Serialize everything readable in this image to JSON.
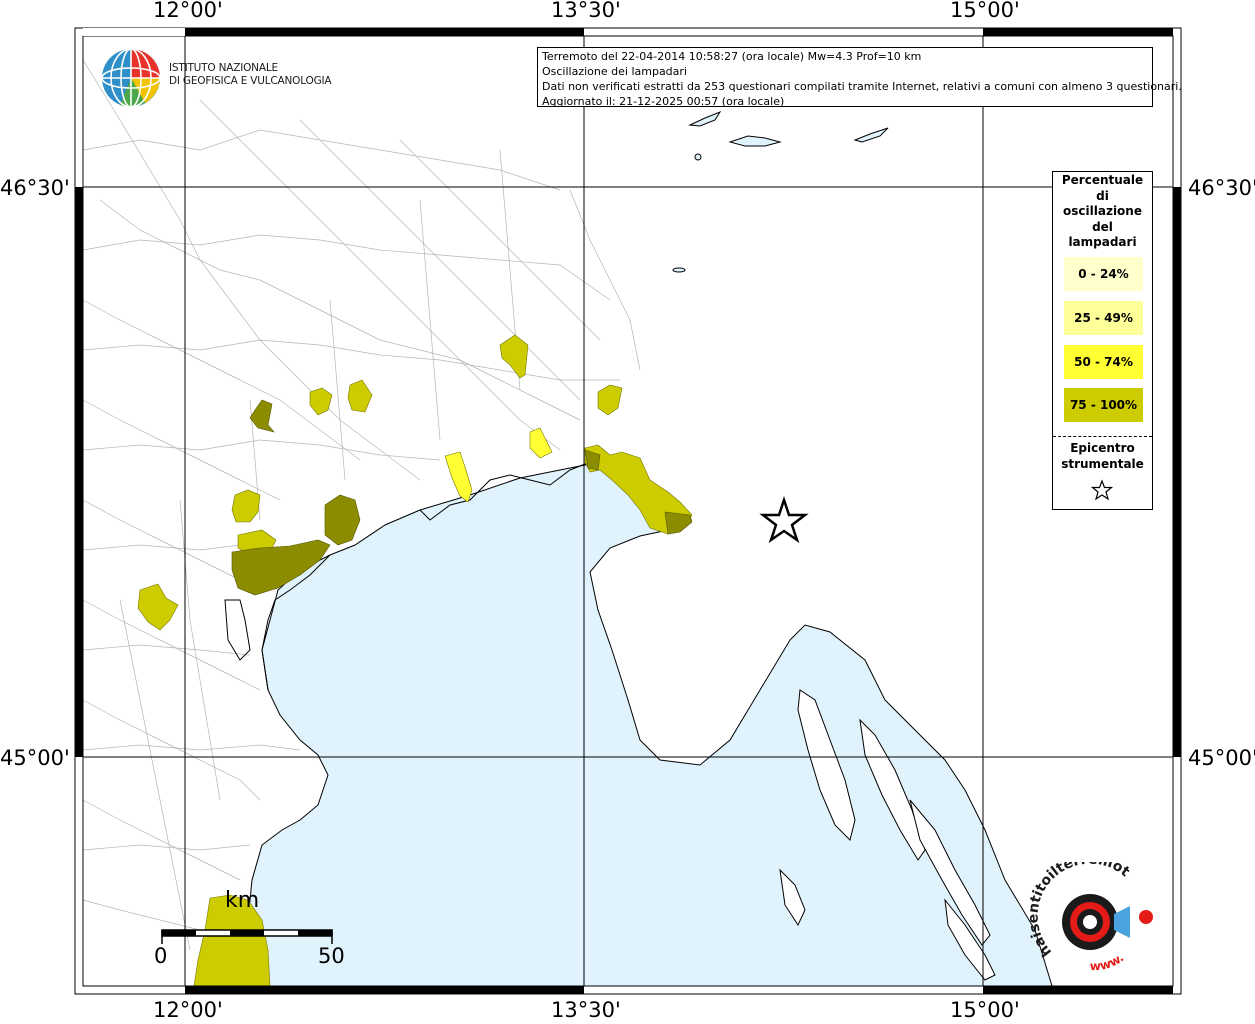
{
  "axes": {
    "top_labels": [
      "12°00'",
      "13°30'",
      "15°00'"
    ],
    "bottom_labels": [
      "12°00'",
      "13°30'",
      "15°00'"
    ],
    "left_labels": [
      "46°30'",
      "45°00'"
    ],
    "right_labels": [
      "46°30'",
      "45°00'"
    ]
  },
  "info": {
    "line1": "Terremoto del 22-04-2014 10:58:27 (ora locale) Mw=4.3 Prof=10 km",
    "line2": "Oscillazione dei lampadari",
    "line3": "Dati non verificati estratti da 253 questionari compilati tramite Internet, relativi a comuni con almeno 3 questionari.",
    "line4": "Aggiornato il: 21-12-2025 00:57 (ora locale)"
  },
  "ingv": {
    "line1": "ISTITUTO NAZIONALE",
    "line2": "DI GEOFISICA E VULCANOLOGIA"
  },
  "legend": {
    "title": [
      "Percentuale",
      "di",
      "oscillazione",
      "del",
      "lampadari"
    ],
    "classes": [
      {
        "label": "0 - 24%",
        "color": "#ffffcc"
      },
      {
        "label": "25 - 49%",
        "color": "#ffff99"
      },
      {
        "label": "50 - 74%",
        "color": "#ffff33"
      },
      {
        "label": "75 - 100%",
        "color": "#cccc00"
      }
    ],
    "epicenter_label": [
      "Epicentro",
      "strumentale"
    ]
  },
  "scale": {
    "unit": "km",
    "min_label": "0",
    "max_label": "50"
  },
  "logo_hst": {
    "text": "haisentitoilterremoto.it",
    "www": "www."
  },
  "colors": {
    "sea": "#e0f2fc",
    "land": "#ffffff",
    "class_dark": "#8c8c00",
    "class_mid": "#cccc00",
    "class_yellow": "#ffff33",
    "hst_red": "#e41b17"
  },
  "map": {
    "epicenter": {
      "lon": 14.0,
      "lat": 45.6
    }
  }
}
